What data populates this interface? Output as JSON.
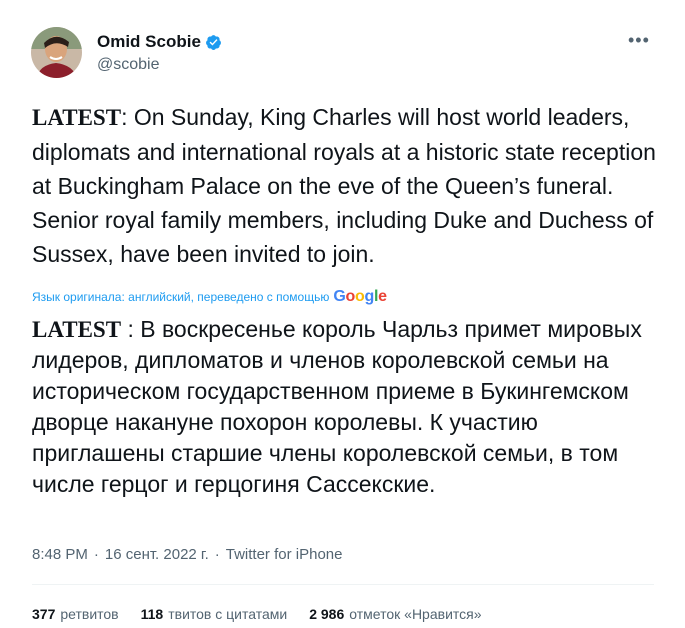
{
  "author": {
    "name": "Omid Scobie",
    "handle": "@scobie"
  },
  "tweet": {
    "en_bold": "LATEST",
    "en_text": ": On Sunday, King Charles will host world leaders, diplomats and international royals at a historic state reception at Buckingham Palace on the eve of the Queen’s funeral. Senior royal family members, including Duke and Duchess of Sussex, have been invited to join.",
    "translation_note": "Язык оригинала: английский, переведено с помощью",
    "translation_provider": "Google",
    "ru_bold": "LATEST",
    "ru_text": " : В воскресенье король Чарльз примет мировых лидеров, дипломатов и членов королевской семьи на историческом государственном приеме в Букингемском дворце накануне похорон королевы. К участию приглашены старшие члены королевской семьи, в том числе герцог и герцогиня Сассекские."
  },
  "meta": {
    "time": "8:48 PM",
    "date": "16 сент. 2022 г.",
    "source": "Twitter for iPhone",
    "separator": "·"
  },
  "stats": {
    "retweets_count": "377",
    "retweets_label": "ретвитов",
    "quotes_count": "118",
    "quotes_label": "твитов с цитатами",
    "likes_count": "2 986",
    "likes_label": "отметок «Нравится»"
  },
  "colors": {
    "text": "#0f1419",
    "secondary": "#536471",
    "accent": "#1d9bf0",
    "verified": "#1d9bf0"
  },
  "icons": {
    "verified": "verified-badge-icon",
    "more": "more-options-icon"
  }
}
